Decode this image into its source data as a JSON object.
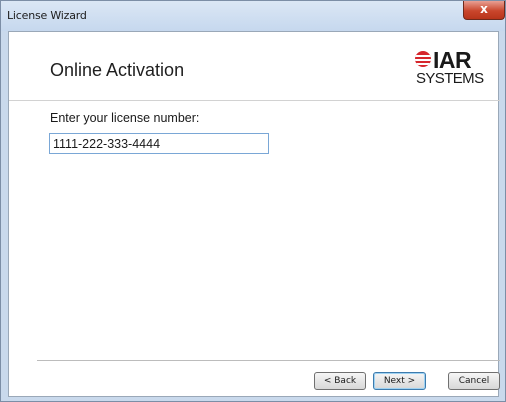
{
  "window": {
    "title": "License Wizard",
    "close_glyph": "x"
  },
  "header": {
    "title": "Online Activation",
    "logo": {
      "brand": "IAR",
      "sub": "SYSTEMS"
    }
  },
  "form": {
    "prompt": "Enter your license number:",
    "license_value": "1111-222-333-4444"
  },
  "buttons": {
    "back": "< Back",
    "next": "Next >",
    "cancel": "Cancel"
  },
  "colors": {
    "logo_red": "#d6262c",
    "window_frame": "#c9d9ec",
    "close_red": "#c9462c"
  }
}
